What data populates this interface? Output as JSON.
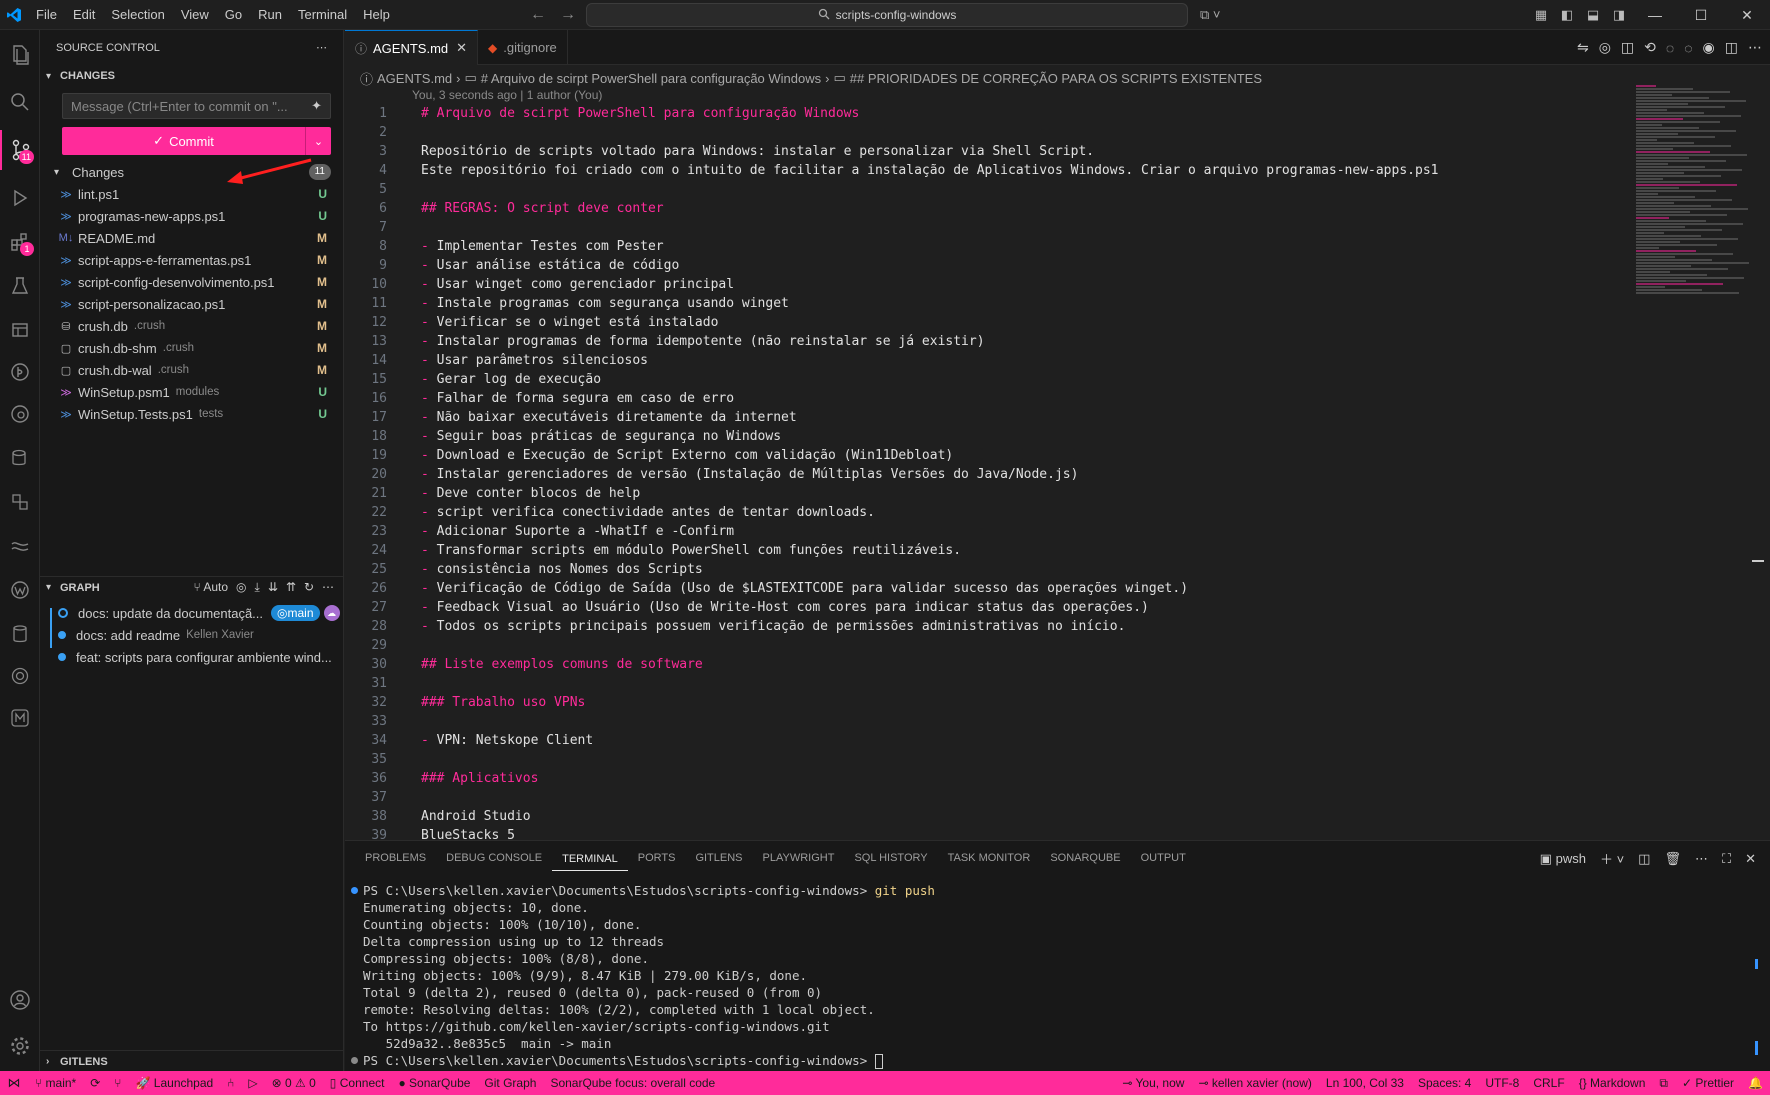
{
  "titlebar": {
    "menu": [
      "File",
      "Edit",
      "Selection",
      "View",
      "Go",
      "Run",
      "Terminal",
      "Help"
    ],
    "search_text": "scripts-config-windows"
  },
  "activity_bar": {
    "icons": [
      "explorer-icon",
      "search-icon",
      "source-control-icon",
      "run-debug-icon",
      "extensions-icon",
      "testing-icon",
      "remote-explorer-icon",
      "gitlens-icon",
      "gitlens-inspect-icon",
      "database-icon",
      "containers-icon",
      "sonar-icon",
      "w-extension-icon",
      "database-cylinder-icon",
      "openai-icon",
      "m-extension-icon",
      "account-icon",
      "settings-gear-icon"
    ],
    "source_control_badge": "11",
    "extensions_badge": "1"
  },
  "sidebar": {
    "title": "SOURCE CONTROL",
    "changes_section": "CHANGES",
    "commit_placeholder": "Message (Ctrl+Enter to commit on \"...",
    "commit_label": "Commit",
    "changes_group_label": "Changes",
    "changes_count": "11",
    "files": [
      {
        "name": "lint.ps1",
        "desc": "",
        "status": "U",
        "type": "ps"
      },
      {
        "name": "programas-new-apps.ps1",
        "desc": "",
        "status": "U",
        "type": "ps"
      },
      {
        "name": "README.md",
        "desc": "",
        "status": "M",
        "type": "md"
      },
      {
        "name": "script-apps-e-ferramentas.ps1",
        "desc": "",
        "status": "M",
        "type": "ps"
      },
      {
        "name": "script-config-desenvolvimento.ps1",
        "desc": "",
        "status": "M",
        "type": "ps"
      },
      {
        "name": "script-personalizacao.ps1",
        "desc": "",
        "status": "M",
        "type": "ps"
      },
      {
        "name": "crush.db",
        "desc": ".crush",
        "status": "M",
        "type": "db"
      },
      {
        "name": "crush.db-shm",
        "desc": ".crush",
        "status": "M",
        "type": "file"
      },
      {
        "name": "crush.db-wal",
        "desc": ".crush",
        "status": "M",
        "type": "file"
      },
      {
        "name": "WinSetup.psm1",
        "desc": "modules",
        "status": "U",
        "type": "mod"
      },
      {
        "name": "WinSetup.Tests.ps1",
        "desc": "tests",
        "status": "U",
        "type": "ps"
      }
    ],
    "graph": {
      "title": "GRAPH",
      "auto_label": "Auto",
      "commits": [
        {
          "message": "docs: update da documentaçã...",
          "author": "",
          "branch": "main"
        },
        {
          "message": "docs: add readme",
          "author": "Kellen Xavier",
          "branch": ""
        },
        {
          "message": "feat: scripts para configurar ambiente wind...",
          "author": "",
          "branch": ""
        }
      ]
    },
    "gitlens_title": "GITLENS"
  },
  "tabs": [
    {
      "label": "AGENTS.md",
      "active": true
    },
    {
      "label": ".gitignore",
      "active": false
    }
  ],
  "breadcrumb": [
    "AGENTS.md",
    "# Arquivo de scirpt PowerShell para configuração Windows",
    "## PRIORIDADES DE CORREÇÃO PARA OS SCRIPTS EXISTENTES"
  ],
  "blame": "You, 3 seconds ago | 1 author (You)",
  "editor_lines": [
    {
      "n": "1",
      "text": "# Arquivo de scirpt PowerShell para configuração Windows",
      "kind": "heading"
    },
    {
      "n": "2",
      "text": "",
      "kind": "plain"
    },
    {
      "n": "3",
      "text": "Repositório de scripts voltado para Windows: instalar e personalizar via Shell Script.",
      "kind": "plain"
    },
    {
      "n": "4",
      "text": "Este repositório foi criado com o intuito de facilitar a instalação de Aplicativos Windows. Criar o arquivo programas-new-apps.ps1",
      "kind": "plain"
    },
    {
      "n": "5",
      "text": "",
      "kind": "plain"
    },
    {
      "n": "6",
      "text": "## REGRAS: O script deve conter",
      "kind": "heading"
    },
    {
      "n": "7",
      "text": "",
      "kind": "plain"
    },
    {
      "n": "8",
      "text": "Implementar Testes com Pester",
      "kind": "bullet"
    },
    {
      "n": "9",
      "text": "Usar análise estática de código",
      "kind": "bullet"
    },
    {
      "n": "10",
      "text": "Usar winget como gerenciador principal",
      "kind": "bullet"
    },
    {
      "n": "11",
      "text": "Instale programas com segurança usando winget",
      "kind": "bullet"
    },
    {
      "n": "12",
      "text": "Verificar se o winget está instalado",
      "kind": "bullet"
    },
    {
      "n": "13",
      "text": "Instalar programas de forma idempotente (não reinstalar se já existir)",
      "kind": "bullet"
    },
    {
      "n": "14",
      "text": "Usar parâmetros silenciosos",
      "kind": "bullet"
    },
    {
      "n": "15",
      "text": "Gerar log de execução",
      "kind": "bullet"
    },
    {
      "n": "16",
      "text": "Falhar de forma segura em caso de erro",
      "kind": "bullet"
    },
    {
      "n": "17",
      "text": "Não baixar executáveis diretamente da internet",
      "kind": "bullet"
    },
    {
      "n": "18",
      "text": "Seguir boas práticas de segurança no Windows",
      "kind": "bullet"
    },
    {
      "n": "19",
      "text": "Download e Execução de Script Externo com validação (Win11Debloat)",
      "kind": "bullet"
    },
    {
      "n": "20",
      "text": "Instalar gerenciadores de versão (Instalação de Múltiplas Versões do Java/Node.js)",
      "kind": "bullet"
    },
    {
      "n": "21",
      "text": "Deve conter blocos de help",
      "kind": "bullet"
    },
    {
      "n": "22",
      "text": "script verifica conectividade antes de tentar downloads.",
      "kind": "bullet"
    },
    {
      "n": "23",
      "text": "Adicionar Suporte a -WhatIf e -Confirm",
      "kind": "bullet"
    },
    {
      "n": "24",
      "text": "Transformar scripts em módulo PowerShell com funções reutilizáveis.",
      "kind": "bullet"
    },
    {
      "n": "25",
      "text": "consistência nos Nomes dos Scripts",
      "kind": "bullet"
    },
    {
      "n": "26",
      "text": "Verificação de Código de Saída (Uso de $LASTEXITCODE para validar sucesso das operações winget.)",
      "kind": "bullet"
    },
    {
      "n": "27",
      "text": "Feedback Visual ao Usuário (Uso de Write-Host com cores para indicar status das operações.)",
      "kind": "bullet"
    },
    {
      "n": "28",
      "text": "Todos os scripts principais possuem verificação de permissões administrativas no início.",
      "kind": "bullet"
    },
    {
      "n": "29",
      "text": "",
      "kind": "plain"
    },
    {
      "n": "30",
      "text": "## Liste exemplos comuns de software",
      "kind": "heading"
    },
    {
      "n": "31",
      "text": "",
      "kind": "plain"
    },
    {
      "n": "32",
      "text": "### Trabalho uso VPNs",
      "kind": "heading"
    },
    {
      "n": "33",
      "text": "",
      "kind": "plain"
    },
    {
      "n": "34",
      "text": "VPN: Netskope Client",
      "kind": "bullet"
    },
    {
      "n": "35",
      "text": "",
      "kind": "plain"
    },
    {
      "n": "36",
      "text": "### Aplicativos",
      "kind": "heading"
    },
    {
      "n": "37",
      "text": "",
      "kind": "plain"
    },
    {
      "n": "38",
      "text": "Android Studio",
      "kind": "plain"
    },
    {
      "n": "39",
      "text": "BlueStacks 5",
      "kind": "plain"
    }
  ],
  "panel": {
    "tabs": [
      "PROBLEMS",
      "DEBUG CONSOLE",
      "TERMINAL",
      "PORTS",
      "GITLENS",
      "PLAYWRIGHT",
      "SQL HISTORY",
      "TASK MONITOR",
      "SONARQUBE",
      "OUTPUT"
    ],
    "active_tab": "TERMINAL",
    "shell_label": "pwsh",
    "terminal_lines": [
      {
        "prompt": "PS C:\\Users\\kellen.xavier\\Documents\\Estudos\\scripts-config-windows> ",
        "cmd": "git push",
        "dot": "blue"
      },
      {
        "prompt": "",
        "cmd": "",
        "text": "Enumerating objects: 10, done."
      },
      {
        "prompt": "",
        "cmd": "",
        "text": "Counting objects: 100% (10/10), done."
      },
      {
        "prompt": "",
        "cmd": "",
        "text": "Delta compression using up to 12 threads"
      },
      {
        "prompt": "",
        "cmd": "",
        "text": "Compressing objects: 100% (8/8), done."
      },
      {
        "prompt": "",
        "cmd": "",
        "text": "Writing objects: 100% (9/9), 8.47 KiB | 279.00 KiB/s, done."
      },
      {
        "prompt": "",
        "cmd": "",
        "text": "Total 9 (delta 2), reused 0 (delta 0), pack-reused 0 (from 0)"
      },
      {
        "prompt": "",
        "cmd": "",
        "text": "remote: Resolving deltas: 100% (2/2), completed with 1 local object."
      },
      {
        "prompt": "",
        "cmd": "",
        "text": "To https://github.com/kellen-xavier/scripts-config-windows.git"
      },
      {
        "prompt": "",
        "cmd": "",
        "text": "   52d9a32..8e835c5  main -> main"
      },
      {
        "prompt": "PS C:\\Users\\kellen.xavier\\Documents\\Estudos\\scripts-config-windows> ",
        "cmd": "",
        "dot": "grey",
        "cursor": true
      }
    ]
  },
  "statusbar": {
    "left": [
      "main*",
      "⟳",
      "",
      "Launchpad",
      "",
      "▷",
      "⊗ 0 ⚠ 0",
      "Connect",
      "● SonarQube",
      "Git Graph",
      "SonarQube focus: overall code"
    ],
    "right": [
      "You, now",
      "kellen xavier (now)",
      "Ln 100, Col 33",
      "Spaces: 4",
      "UTF-8",
      "CRLF",
      "{} Markdown",
      "",
      "✓ Prettier",
      ""
    ]
  },
  "colors": {
    "accent": "#ff2b9a",
    "editor_bg": "#1f1f1f",
    "sidebar_bg": "#181818",
    "untracked": "#73c991",
    "modified": "#e2c08d",
    "branch_pill": "#1e8ad6"
  }
}
